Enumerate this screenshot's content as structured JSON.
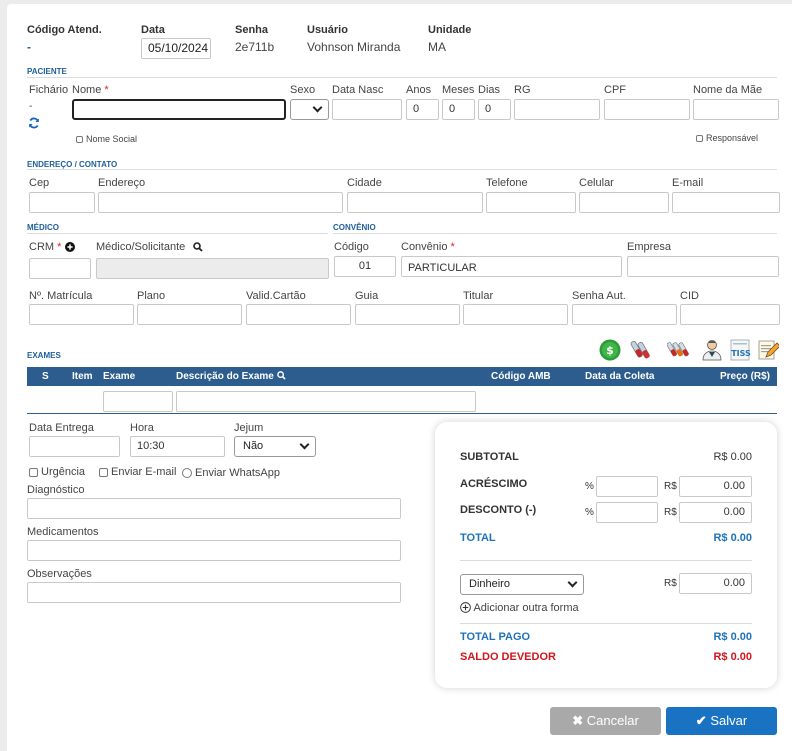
{
  "header": {
    "codigo_label": "Código Atend.",
    "codigo_value": "-",
    "data_label": "Data",
    "data_value": "05/10/2024",
    "senha_label": "Senha",
    "senha_value": "2e711b",
    "usuario_label": "Usuário",
    "usuario_value": "Vohnson Miranda",
    "unidade_label": "Unidade",
    "unidade_value": "MA"
  },
  "paciente": {
    "section": "PACIENTE",
    "fichario_label": "Fichário",
    "fichario_value": "-",
    "nome_label": "Nome",
    "required_mark": "*",
    "sexo_label": "Sexo",
    "data_nasc_label": "Data Nasc",
    "anos_label": "Anos",
    "anos_value": "0",
    "meses_label": "Meses",
    "meses_value": "0",
    "dias_label": "Dias",
    "dias_value": "0",
    "rg_label": "RG",
    "cpf_label": "CPF",
    "nome_mae_label": "Nome da Mãe",
    "nome_social_label": "Nome Social",
    "responsavel_label": "Responsável"
  },
  "endereco": {
    "section": "ENDEREÇO / CONTATO",
    "cep_label": "Cep",
    "endereco_label": "Endereço",
    "cidade_label": "Cidade",
    "telefone_label": "Telefone",
    "celular_label": "Celular",
    "email_label": "E-mail"
  },
  "medico": {
    "section": "MÉDICO",
    "crm_label": "CRM",
    "solicitante_label": "Médico/Solicitante"
  },
  "convenio": {
    "section": "CONVÊNIO",
    "codigo_label": "Código",
    "codigo_value": "01",
    "convenio_label": "Convênio",
    "convenio_value": "PARTICULAR",
    "empresa_label": "Empresa"
  },
  "extra": {
    "matricula_label": "Nº. Matrícula",
    "plano_label": "Plano",
    "valid_label": "Valid.Cartão",
    "guia_label": "Guia",
    "titular_label": "Titular",
    "senha_aut_label": "Senha Aut.",
    "cid_label": "CID"
  },
  "exames": {
    "section": "EXAMES",
    "columns": [
      "S",
      "Item",
      "Exame",
      "Descrição do Exame",
      "Código AMB",
      "Data da Coleta",
      "Preço (R$)"
    ],
    "toolbar_icons": [
      "money-bag-icon",
      "blood-tubes-icon",
      "lab-tubes-icon",
      "doctor-icon",
      "tiss-icon",
      "edit-document-icon"
    ],
    "tiss_text": "TISS"
  },
  "entrega": {
    "data_entrega_label": "Data Entrega",
    "hora_label": "Hora",
    "hora_value": "10:30",
    "jejum_label": "Jejum",
    "jejum_value": "Não",
    "urgencia_label": "Urgência",
    "email_label": "Enviar E-mail",
    "whatsapp_label": "Enviar WhatsApp",
    "diagnostico_label": "Diagnóstico",
    "medicamentos_label": "Medicamentos",
    "observacoes_label": "Observações"
  },
  "totals": {
    "subtotal_label": "SUBTOTAL",
    "subtotal_value": "R$ 0.00",
    "acrescimo_label": "ACRÉSCIMO",
    "desconto_label": "DESCONTO (-)",
    "percent_symbol": "%",
    "currency_symbol": "R$",
    "acrescimo_value": "0.00",
    "desconto_value": "0.00",
    "total_label": "TOTAL",
    "total_value": "R$ 0.00",
    "payment_method": "Dinheiro",
    "payment_value": "0.00",
    "add_payment_label": "Adicionar outra forma",
    "total_pago_label": "TOTAL PAGO",
    "total_pago_value": "R$ 0.00",
    "saldo_label": "SALDO DEVEDOR",
    "saldo_value": "R$ 0.00"
  },
  "actions": {
    "cancel_label": "Cancelar",
    "save_label": "Salvar"
  },
  "colors": {
    "header_bar": "#2d5d8e",
    "section_blue": "#1e5f9b",
    "total_blue": "#1e73b8",
    "saldo_red": "#d0161b",
    "save_button": "#1a73c2",
    "cancel_button": "#a9a9a9"
  }
}
